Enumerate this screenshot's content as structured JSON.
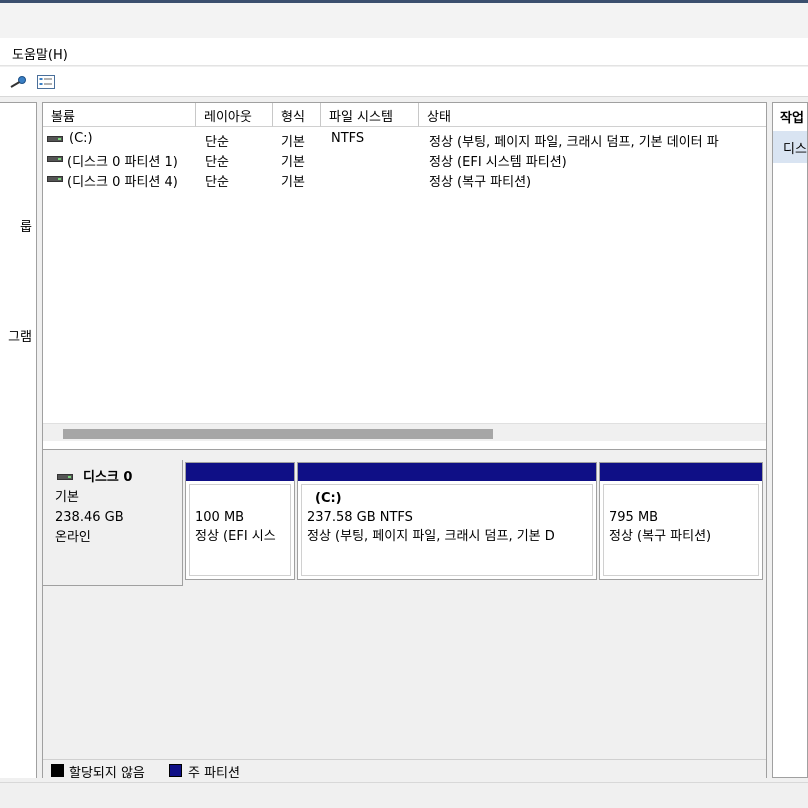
{
  "menubar": {
    "help": "도움말(H)"
  },
  "left_tree": {
    "item_1": "룹",
    "item_2": "그램"
  },
  "volume_table": {
    "headers": [
      "볼륨",
      "레이아웃",
      "형식",
      "파일 시스템",
      "상태"
    ],
    "rows": [
      {
        "volume": "(C:)",
        "layout": "단순",
        "type": "기본",
        "fs": "NTFS",
        "status": "정상 (부팅, 페이지 파일, 크래시 덤프, 기본 데이터 파"
      },
      {
        "volume": "(디스크 0 파티션 1)",
        "layout": "단순",
        "type": "기본",
        "fs": "",
        "status": "정상 (EFI 시스템 파티션)"
      },
      {
        "volume": "(디스크 0 파티션 4)",
        "layout": "단순",
        "type": "기본",
        "fs": "",
        "status": "정상 (복구 파티션)"
      }
    ]
  },
  "disk": {
    "name": "디스크 0",
    "type": "기본",
    "size": "238.46 GB",
    "state": "온라인",
    "partitions": [
      {
        "title": "",
        "size": "100 MB",
        "status": "정상 (EFI 시스"
      },
      {
        "title": "(C:)",
        "size": "237.58 GB NTFS",
        "status": "정상 (부팅, 페이지 파일, 크래시 덤프, 기본 D"
      },
      {
        "title": "",
        "size": "795 MB",
        "status": "정상 (복구 파티션)"
      }
    ]
  },
  "legend": {
    "unallocated": "할당되지 않음",
    "primary": "주 파티션"
  },
  "actions": {
    "header": "작업",
    "item": "디스"
  },
  "colors": {
    "primary_partition": "#0f0f86",
    "unallocated": "#000000",
    "selection": "#d9e4f2"
  }
}
